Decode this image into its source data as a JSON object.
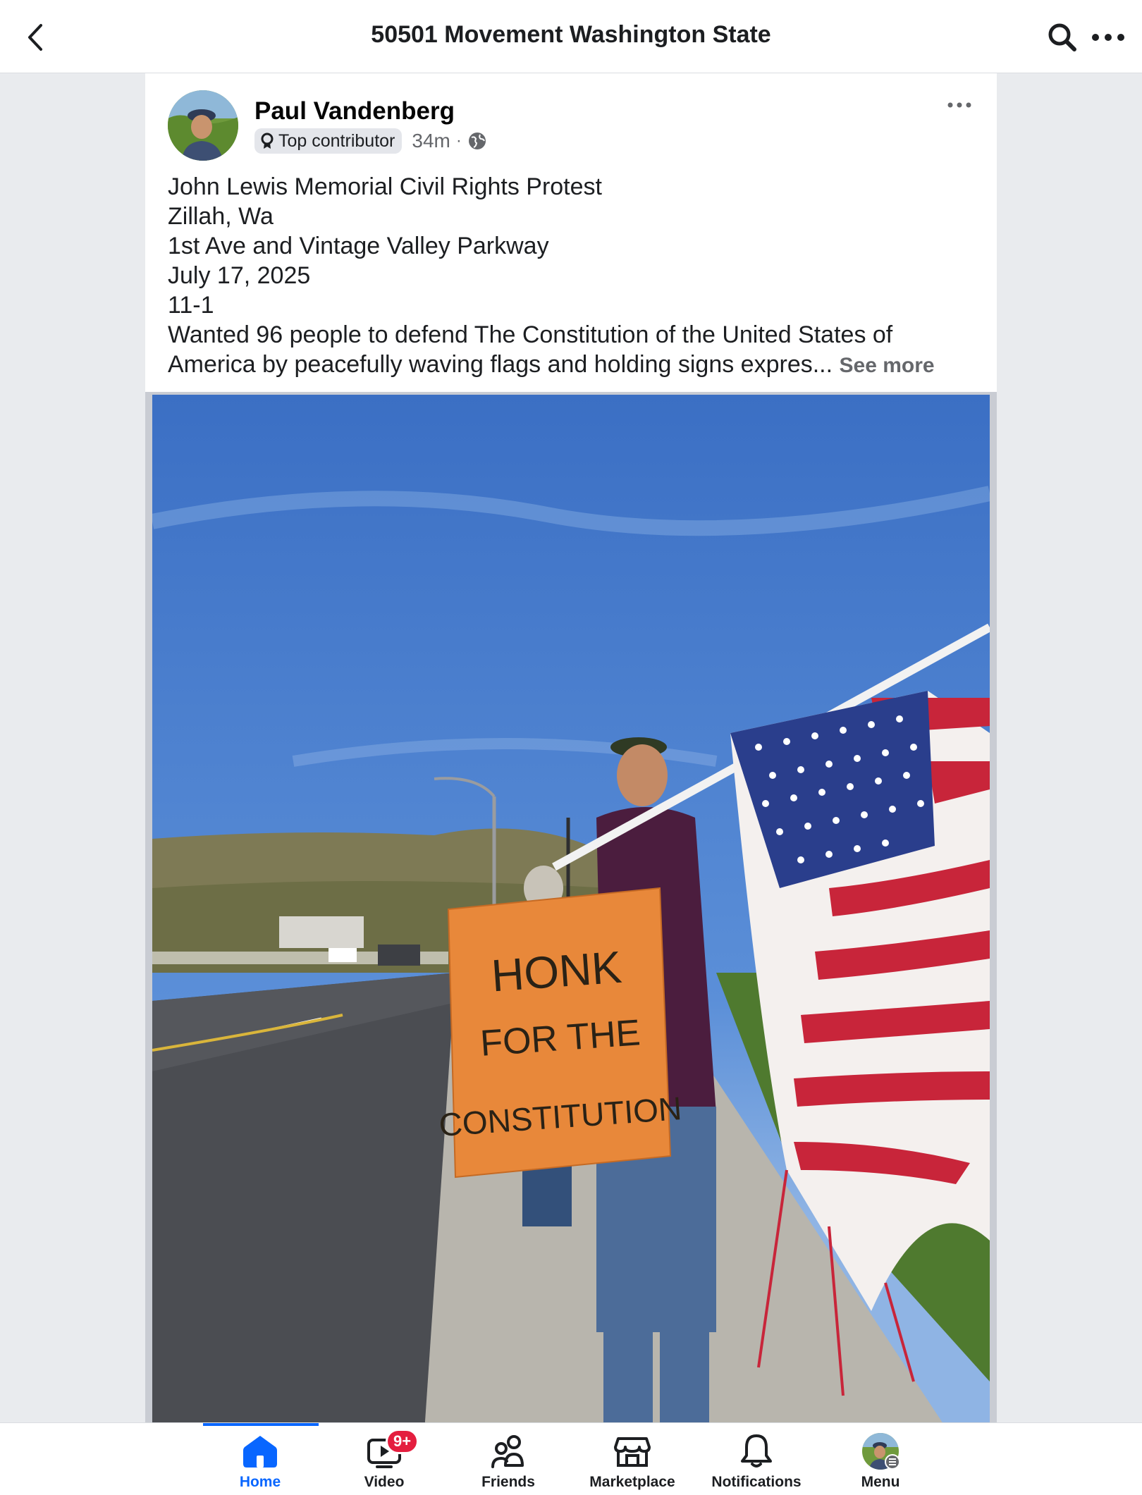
{
  "header": {
    "title": "50501 Movement Washington State"
  },
  "post": {
    "author": "Paul Vandenberg",
    "badge": "Top contributor",
    "time": "34m",
    "separator": "·",
    "lines": [
      "John Lewis Memorial Civil Rights Protest",
      "Zillah, Wa",
      "1st Ave and Vintage Valley Parkway",
      "July 17, 2025",
      "11-1",
      "Wanted 96 people to defend The Constitution of the United States of"
    ],
    "last_line": "America by peacefully waving flags and holding signs expres...",
    "see_more": "See more",
    "sign_text": [
      "HONK",
      "FOR THE",
      "CONSTITUTION"
    ]
  },
  "nav": {
    "items": [
      {
        "label": "Home",
        "icon": "home-icon",
        "active": true
      },
      {
        "label": "Video",
        "icon": "video-icon",
        "badge": "9+"
      },
      {
        "label": "Friends",
        "icon": "friends-icon"
      },
      {
        "label": "Marketplace",
        "icon": "marketplace-icon"
      },
      {
        "label": "Notifications",
        "icon": "bell-icon"
      },
      {
        "label": "Menu",
        "icon": "avatar-menu-icon"
      }
    ]
  },
  "colors": {
    "accent": "#0866ff",
    "badge_red": "#e41e3f",
    "secondary_text": "#65676b"
  }
}
